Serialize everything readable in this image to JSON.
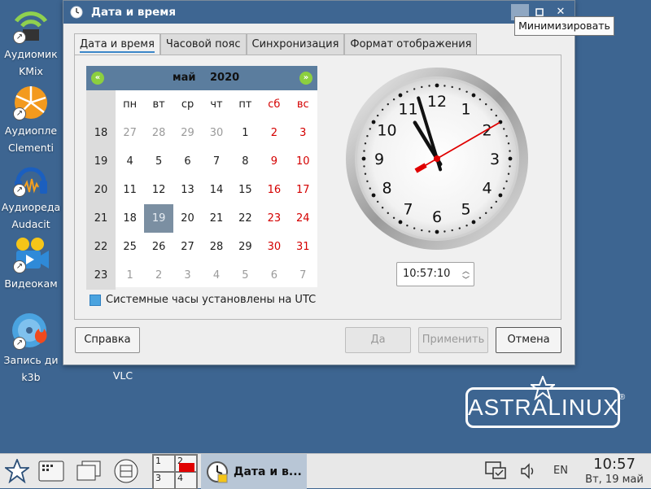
{
  "desktop": {
    "icons": [
      {
        "name": "kmix",
        "line1": "Аудиомик",
        "line2": "KMix"
      },
      {
        "name": "clementine",
        "line1": "Аудиопле",
        "line2": "Clementi"
      },
      {
        "name": "audacity",
        "line1": "Аудиореда",
        "line2": "Audacit"
      },
      {
        "name": "videocam",
        "line1": "Видеокам",
        "line2": ""
      },
      {
        "name": "k3b",
        "line1": "Запись ди",
        "line2": "k3b"
      }
    ],
    "vlc_label": "VLC",
    "logo_text": "ASTRALINUX",
    "logo_reg": "®"
  },
  "dialog": {
    "title": "Дата и время",
    "tooltip": "Минимизировать",
    "tabs": [
      "Дата и время",
      "Часовой пояс",
      "Синхронизация",
      "Формат отображения"
    ],
    "calendar": {
      "month": "май",
      "year": "2020",
      "weekday_headers": [
        "пн",
        "вт",
        "ср",
        "чт",
        "пт",
        "сб",
        "вс"
      ],
      "weeks": [
        {
          "num": "18",
          "days": [
            "27",
            "28",
            "29",
            "30",
            "1",
            "2",
            "3"
          ]
        },
        {
          "num": "19",
          "days": [
            "4",
            "5",
            "6",
            "7",
            "8",
            "9",
            "10"
          ]
        },
        {
          "num": "20",
          "days": [
            "11",
            "12",
            "13",
            "14",
            "15",
            "16",
            "17"
          ]
        },
        {
          "num": "21",
          "days": [
            "18",
            "19",
            "20",
            "21",
            "22",
            "23",
            "24"
          ]
        },
        {
          "num": "22",
          "days": [
            "25",
            "26",
            "27",
            "28",
            "29",
            "30",
            "31"
          ]
        },
        {
          "num": "23",
          "days": [
            "1",
            "2",
            "3",
            "4",
            "5",
            "6",
            "7"
          ]
        }
      ],
      "selected_day": "19",
      "prev_icon": "chevron-double-left-icon",
      "next_icon": "chevron-double-right-icon"
    },
    "clock": {
      "numbers": [
        "12",
        "1",
        "2",
        "3",
        "4",
        "5",
        "6",
        "7",
        "8",
        "9",
        "10",
        "11"
      ],
      "time": {
        "h": 10,
        "m": 57,
        "s": 10
      },
      "second_hand_color": "#e00000"
    },
    "time_value": "10:57:10",
    "utc_checkbox": {
      "label": "Системные часы установлены на UTC",
      "checked": true
    },
    "buttons": {
      "help": "Справка",
      "ok": "Да",
      "apply": "Применить",
      "cancel": "Отмена"
    }
  },
  "taskbar": {
    "pager": [
      "1",
      "2",
      "3",
      "4"
    ],
    "task_title": "Дата и в...",
    "lang": "EN",
    "time": "10:57",
    "date": "Вт, 19 май"
  },
  "colors": {
    "desktop_bg": "#3d6591",
    "titlebar": "#3e6692",
    "selected_day": "#7b8fa2",
    "weekend": "#d40000"
  }
}
